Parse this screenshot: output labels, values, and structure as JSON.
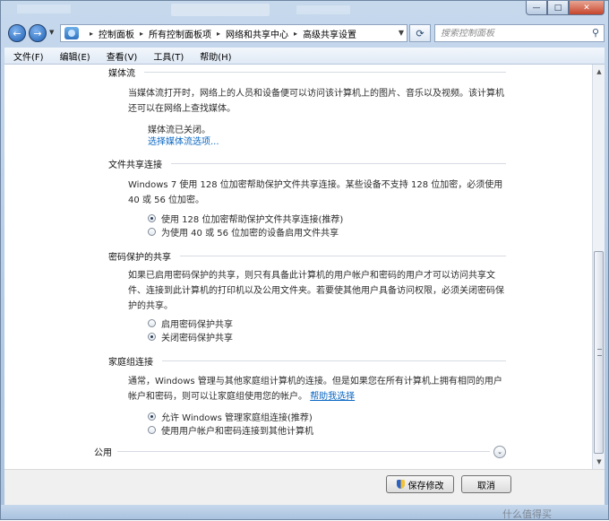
{
  "window": {
    "minimize_glyph": "—",
    "maximize_glyph": "□",
    "close_glyph": "✕"
  },
  "address": {
    "back_glyph": "←",
    "forward_glyph": "→",
    "crumbs": [
      "控制面板",
      "所有控制面板项",
      "网络和共享中心",
      "高级共享设置"
    ],
    "refresh_glyph": "⟳",
    "search_placeholder": "搜索控制面板"
  },
  "menu": [
    {
      "label": "文件(F)"
    },
    {
      "label": "编辑(E)"
    },
    {
      "label": "查看(V)"
    },
    {
      "label": "工具(T)"
    },
    {
      "label": "帮助(H)"
    }
  ],
  "sections": {
    "media": {
      "title": "媒体流",
      "desc": "当媒体流打开时，网络上的人员和设备便可以访问该计算机上的图片、音乐以及视频。该计算机还可以在网络上查找媒体。",
      "status": "媒体流已关闭。",
      "link": "选择媒体流选项..."
    },
    "file_sharing": {
      "title": "文件共享连接",
      "desc": "Windows 7 使用 128 位加密帮助保护文件共享连接。某些设备不支持 128 位加密，必须使用 40 或 56 位加密。",
      "options": [
        {
          "label": "使用 128 位加密帮助保护文件共享连接(推荐)",
          "checked": true
        },
        {
          "label": "为使用 40 或 56 位加密的设备启用文件共享",
          "checked": false
        }
      ]
    },
    "password": {
      "title": "密码保护的共享",
      "desc": "如果已启用密码保护的共享，则只有具备此计算机的用户帐户和密码的用户才可以访问共享文件、连接到此计算机的打印机以及公用文件夹。若要使其他用户具备访问权限，必须关闭密码保护的共享。",
      "options": [
        {
          "label": "启用密码保护共享",
          "checked": false
        },
        {
          "label": "关闭密码保护共享",
          "checked": true
        }
      ]
    },
    "homegroup": {
      "title": "家庭组连接",
      "desc": "通常，Windows 管理与其他家庭组计算机的连接。但是如果您在所有计算机上拥有相同的用户帐户和密码，则可以让家庭组使用您的帐户。",
      "help_link": "帮助我选择",
      "options": [
        {
          "label": "允许 Windows 管理家庭组连接(推荐)",
          "checked": true
        },
        {
          "label": "使用用户帐户和密码连接到其他计算机",
          "checked": false
        }
      ]
    },
    "public": {
      "title": "公用",
      "expand_glyph": "⌄"
    }
  },
  "buttons": {
    "save": "保存修改",
    "cancel": "取消"
  },
  "watermark": "什么值得买"
}
